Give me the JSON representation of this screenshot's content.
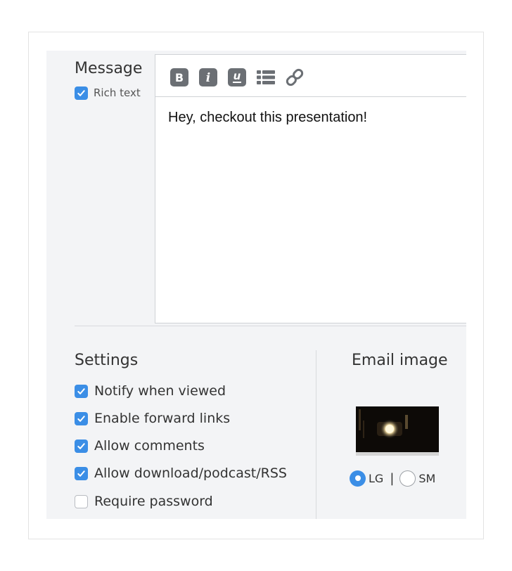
{
  "message": {
    "label": "Message",
    "rich_text_label": "Rich text",
    "rich_text_checked": true
  },
  "editor": {
    "toolbar": [
      "bold-icon",
      "italic-icon",
      "underline-icon",
      "list-icon",
      "link-icon"
    ],
    "bold_glyph": "B",
    "italic_glyph": "i",
    "underline_glyph": "u",
    "content": "Hey, checkout this presentation!"
  },
  "settings": {
    "title": "Settings",
    "items": [
      {
        "label": "Notify when viewed",
        "checked": true
      },
      {
        "label": "Enable forward links",
        "checked": true
      },
      {
        "label": "Allow comments",
        "checked": true
      },
      {
        "label": "Allow download/podcast/RSS",
        "checked": true
      },
      {
        "label": "Require password",
        "checked": false
      }
    ]
  },
  "email_image": {
    "title": "Email image",
    "sizes": [
      {
        "label": "LG",
        "selected": true
      },
      {
        "label": "SM",
        "selected": false
      }
    ],
    "separator": "|"
  },
  "colors": {
    "accent": "#3b8ee6",
    "panel_bg": "#f3f4f6",
    "toolbar_icon": "#6b6f74"
  }
}
